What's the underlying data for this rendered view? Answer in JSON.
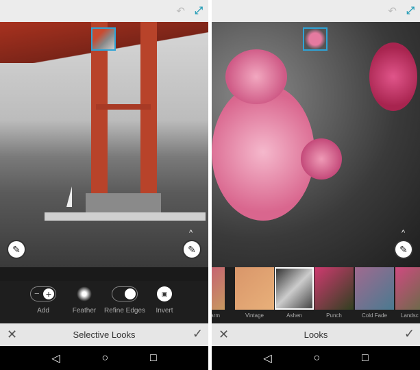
{
  "left": {
    "title": "Selective Looks",
    "icons": {
      "undo": "undo-icon",
      "expand": "expand-icon"
    },
    "tools": [
      {
        "label": "Add"
      },
      {
        "label": "Feather"
      },
      {
        "label": "Refine Edges"
      },
      {
        "label": "Invert"
      }
    ]
  },
  "right": {
    "title": "Looks",
    "looks": [
      {
        "label": "arm"
      },
      {
        "label": "Vintage"
      },
      {
        "label": "Ashen",
        "selected": true
      },
      {
        "label": "Punch"
      },
      {
        "label": "Cold Fade"
      },
      {
        "label": "Landsc"
      }
    ]
  },
  "glyphs": {
    "undo": "↶",
    "expand": "⤢",
    "close": "✕",
    "check": "✓",
    "back": "◁",
    "home": "○",
    "recents": "□",
    "caret": "^",
    "wand": "✎",
    "plus": "+",
    "minus": "−",
    "invert": "▣"
  },
  "colors": {
    "accent": "#2ea3d6",
    "bridge": "#c94a30"
  }
}
